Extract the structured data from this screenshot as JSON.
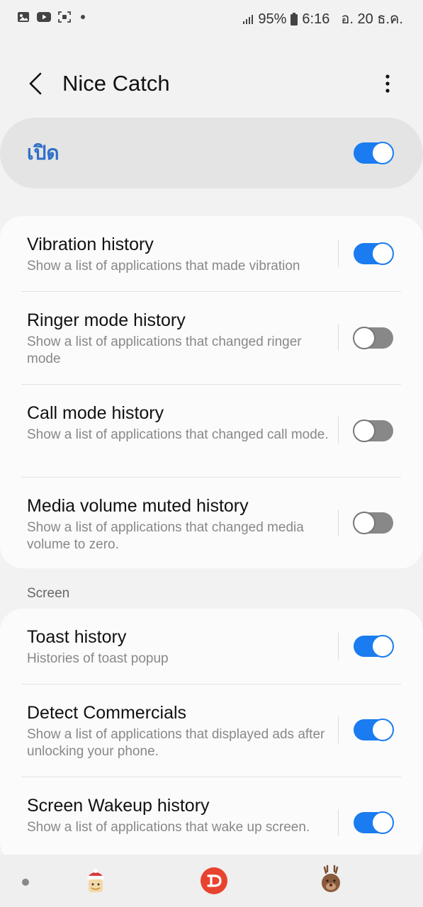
{
  "status_bar": {
    "icons_left": [
      "gallery-icon",
      "youtube-icon",
      "screen-record-icon",
      "notification-dot-icon"
    ],
    "signal_icon": "signal-icon",
    "battery": "95%",
    "battery_icon": "battery-icon",
    "time": "6:16",
    "date": "อ. 20 ธ.ค."
  },
  "app_bar": {
    "back_icon": "back-arrow-icon",
    "title": "Nice Catch",
    "more_icon": "more-vert-icon"
  },
  "master": {
    "label": "เปิด",
    "enabled": true
  },
  "groups": [
    {
      "header": "",
      "items": [
        {
          "title": "Vibration history",
          "subtitle": "Show a list of applications that made vibration",
          "enabled": true
        },
        {
          "title": "Ringer mode history",
          "subtitle": "Show a list of applications that changed ringer mode",
          "enabled": false
        },
        {
          "title": "Call mode history",
          "subtitle": "Show a list of applications that changed call mode.",
          "enabled": false
        },
        {
          "title": "Media volume muted history",
          "subtitle": "Show a list of applications that changed media volume to zero.",
          "enabled": false
        }
      ]
    },
    {
      "header": "Screen",
      "items": [
        {
          "title": "Toast history",
          "subtitle": "Histories of toast popup",
          "enabled": true
        },
        {
          "title": "Detect Commercials",
          "subtitle": "Show a list of applications that displayed ads after unlocking your phone.",
          "enabled": true
        },
        {
          "title": "Screen Wakeup history",
          "subtitle": "Show a list of applications that wake up screen.",
          "enabled": true
        }
      ]
    }
  ],
  "nav_bar": {
    "icons": [
      "nav-dot-icon",
      "santa-sticker-icon",
      "app-logo-icon",
      "reindeer-sticker-icon"
    ]
  },
  "colors": {
    "accent": "#1a7cf0",
    "master_label": "#2f6fc7",
    "toggle_off": "#888888",
    "background": "#f2f2f2",
    "card": "#fbfbfb"
  }
}
